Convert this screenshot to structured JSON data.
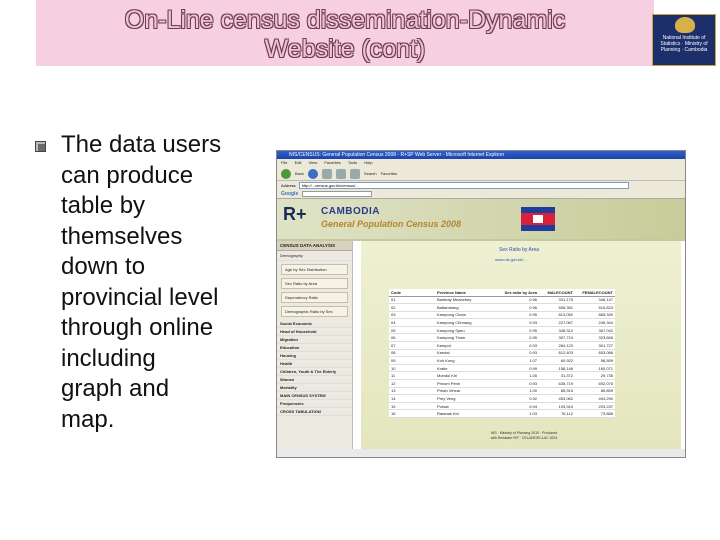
{
  "slide": {
    "title_line1": "On-Line census dissemination-Dynamic",
    "title_line2": "Website (cont)",
    "logo_text": "National Institute of Statistics · Ministry of Planning · Cambodia",
    "bullet_lines": [
      "The data users",
      "can produce",
      "table by",
      "themselves",
      "down to",
      "provincial level",
      "through  online",
      "including",
      "graph and",
      "map."
    ]
  },
  "browser": {
    "window_title": "NIS/CENSUS: General Population Census 2008 - R+SP Web Server - Microsoft Internet Explorer",
    "menu": [
      "File",
      "Edit",
      "View",
      "Favorites",
      "Tools",
      "Help"
    ],
    "toolbar": [
      "Back",
      "Search",
      "Favorites"
    ],
    "address_label": "Address",
    "address": "http://...census.gov.kh/census/...",
    "google_label": "Google",
    "banner_line1": "CAMBODIA",
    "banner_line2": "General Population Census 2008",
    "banner_logo": "R+",
    "sidebar": {
      "header": "CENSUS DATA ANALYSIS",
      "sub": "Demography",
      "buttons": [
        "Age by Sex Distribution",
        "Sex Ratio by Area",
        "Dependency Ratio",
        "Demographic Ratio by Sex"
      ],
      "items": [
        "Social Economic",
        "Head of Household",
        "Migration",
        "Education",
        "Housing",
        "Health",
        "Children, Youth & The Elderly",
        "Women",
        "Mortality",
        "MAIN CENSUS SYSTEM",
        "Frequencies",
        "CROSS TABULATION"
      ]
    },
    "main": {
      "title": "Sex Ratio by Area",
      "link": "www.nis.gov.kh/...",
      "columns": [
        "Code",
        "Province Name",
        "Sex ratio by Area",
        "MALECOUNT",
        "FEMALECOUNT"
      ],
      "rows": [
        [
          "01",
          "Banteay Meanchey",
          "0.96",
          "331,175",
          "346,147"
        ],
        [
          "02",
          "Battambang",
          "0.96",
          "506,351",
          "516,823"
        ],
        [
          "03",
          "Kampong Cham",
          "0.95",
          "813,052",
          "865,330"
        ],
        [
          "04",
          "Kampong Chhnang",
          "0.93",
          "227,067",
          "245,344"
        ],
        [
          "05",
          "Kampong Speu",
          "0.95",
          "348,312",
          "367,042"
        ],
        [
          "06",
          "Kampong Thom",
          "0.95",
          "307,724",
          "323,665"
        ],
        [
          "07",
          "Kampot",
          "0.93",
          "284,123",
          "301,727"
        ],
        [
          "08",
          "Kandal",
          "0.93",
          "612,403",
          "653,086"
        ],
        [
          "09",
          "Koh Kong",
          "1.07",
          "60,922",
          "56,559"
        ],
        [
          "10",
          "Kratie",
          "0.99",
          "158,146",
          "160,071"
        ],
        [
          "11",
          "Mondul Kiri",
          "1.05",
          "31,372",
          "29,735"
        ],
        [
          "12",
          "Phnom Penh",
          "0.93",
          "635,719",
          "692,076"
        ],
        [
          "13",
          "Preah Vihear",
          "1.00",
          "85,910",
          "85,859"
        ],
        [
          "14",
          "Prey Veng",
          "0.92",
          "453,062",
          "494,290"
        ],
        [
          "15",
          "Pursat",
          "0.94",
          "193,924",
          "203,237"
        ],
        [
          "16",
          "Ratanak Kiri",
          "1.03",
          "76,112",
          "73,885"
        ]
      ],
      "footer": "NIS · Ministry of Planning 2010 · Produced with Redatam+SP · CELADE/ECLAC 2004"
    },
    "taskbar": {
      "start": "start"
    }
  }
}
